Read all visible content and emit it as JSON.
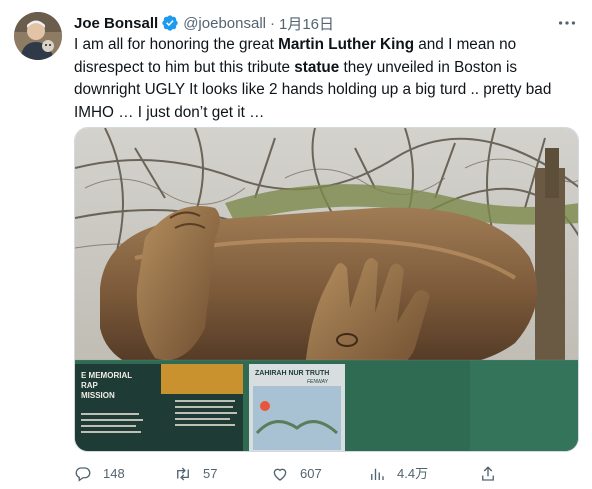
{
  "tweet": {
    "author_name": "Joe Bonsall",
    "handle": "@joebonsall",
    "separator": "·",
    "date": "1月16日",
    "text_segments": [
      {
        "t": "I am all for honoring the great ",
        "bold": false
      },
      {
        "t": "Martin Luther King",
        "bold": true
      },
      {
        "t": " and I mean no disrespect to him but this tribute ",
        "bold": false
      },
      {
        "t": "statue",
        "bold": true
      },
      {
        "t": " they unveiled in Boston is downright UGLY It looks like 2 hands holding up a big turd .. pretty bad IMHO … I just don’t get it …",
        "bold": false
      }
    ]
  },
  "media": {
    "panel_left_lines": [
      "E MEMORIAL",
      "RAP",
      "MISSION"
    ],
    "panel_middle_name": "ZAHIRAH NUR TRUTH",
    "panel_middle_sub": "FENWAY"
  },
  "actions": {
    "replies": "148",
    "retweets": "57",
    "likes": "607",
    "views": "4.4万"
  },
  "colors": {
    "verified": "#1d9bf0",
    "muted": "#536471",
    "text": "#0f1419",
    "fence": "#2f6b53"
  },
  "icons": {
    "verified": "verified-badge-icon",
    "more": "more-icon",
    "reply": "reply-icon",
    "retweet": "retweet-icon",
    "like": "heart-icon",
    "views": "analytics-icon",
    "share": "share-icon"
  }
}
